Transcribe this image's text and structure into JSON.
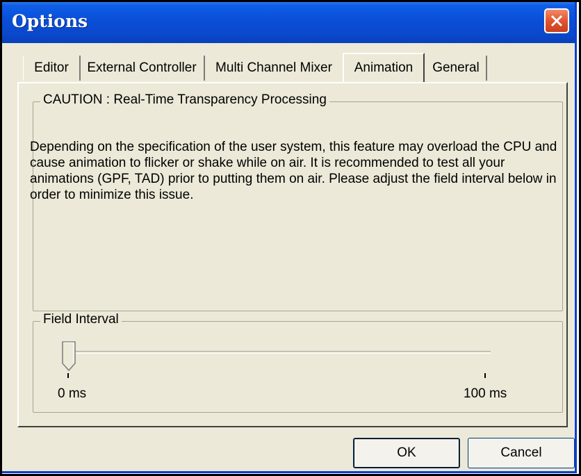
{
  "window": {
    "title": "Options"
  },
  "tabs": [
    {
      "label": "Editor"
    },
    {
      "label": "External Controller"
    },
    {
      "label": "Multi Channel Mixer"
    },
    {
      "label": "Animation",
      "active": true
    },
    {
      "label": "General"
    }
  ],
  "caution": {
    "legend": "CAUTION : Real-Time Transparency Processing",
    "text": "Depending on the specification of the user system, this feature may overload the CPU and cause animation to flicker or shake while on air.  It is recommended to test all your animations (GPF, TAD) prior to putting them on air.   Please adjust the field interval below in order to minimize this issue."
  },
  "field_interval": {
    "legend": "Field Interval",
    "min_label": "0 ms",
    "max_label": "100 ms",
    "value": 0
  },
  "buttons": {
    "ok": "OK",
    "cancel": "Cancel"
  },
  "colors": {
    "titlebar": "#0a4fd8",
    "close": "#e0552e",
    "face": "#ece9d8"
  },
  "icons": {
    "close": "close-icon"
  }
}
